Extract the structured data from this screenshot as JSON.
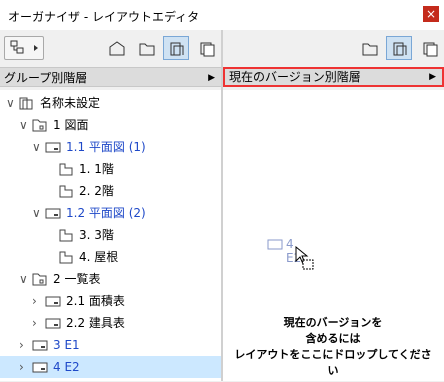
{
  "window": {
    "title": "オーガナイザ - レイアウトエディタ",
    "close_glyph": "×"
  },
  "left": {
    "header": "グループ別階層",
    "tree": [
      {
        "label": "名称未設定",
        "level": 0,
        "chev": "v",
        "icon": "book-icon",
        "blue": false
      },
      {
        "label": "1 図面",
        "level": 1,
        "chev": "v",
        "icon": "folder-icon",
        "blue": false
      },
      {
        "label": "1.1 平面図 (1)",
        "level": 2,
        "chev": "v",
        "icon": "layout-icon",
        "blue": true
      },
      {
        "label": "1. 1階",
        "level": 3,
        "chev": "",
        "icon": "page-icon",
        "blue": false
      },
      {
        "label": "2. 2階",
        "level": 3,
        "chev": "",
        "icon": "page-icon",
        "blue": false
      },
      {
        "label": "1.2 平面図 (2)",
        "level": 2,
        "chev": "v",
        "icon": "layout-icon",
        "blue": true
      },
      {
        "label": "3. 3階",
        "level": 3,
        "chev": "",
        "icon": "page-icon",
        "blue": false
      },
      {
        "label": "4. 屋根",
        "level": 3,
        "chev": "",
        "icon": "page-icon",
        "blue": false
      },
      {
        "label": "2 一覧表",
        "level": 1,
        "chev": "v",
        "icon": "folder-icon",
        "blue": false
      },
      {
        "label": "2.1 面積表",
        "level": 2,
        "chev": ">",
        "icon": "layout-icon",
        "blue": false
      },
      {
        "label": "2.2 建具表",
        "level": 2,
        "chev": ">",
        "icon": "layout-icon",
        "blue": false
      },
      {
        "label": "3 E1",
        "level": 1,
        "chev": ">",
        "icon": "layout-icon",
        "blue": true
      },
      {
        "label": "4 E2",
        "level": 1,
        "chev": ">",
        "icon": "layout-icon",
        "blue": true,
        "selected": true
      }
    ]
  },
  "right": {
    "header": "現在のバージョン別階層",
    "ghost_label": "4 E2",
    "drop_message": [
      "現在のバージョンを",
      "含めるには",
      "レイアウトをここにドロップしてください"
    ]
  },
  "colors": {
    "accent_blue": "#1f49c8",
    "selected_row": "#cce8ff",
    "highlight_border": "#e33333"
  }
}
